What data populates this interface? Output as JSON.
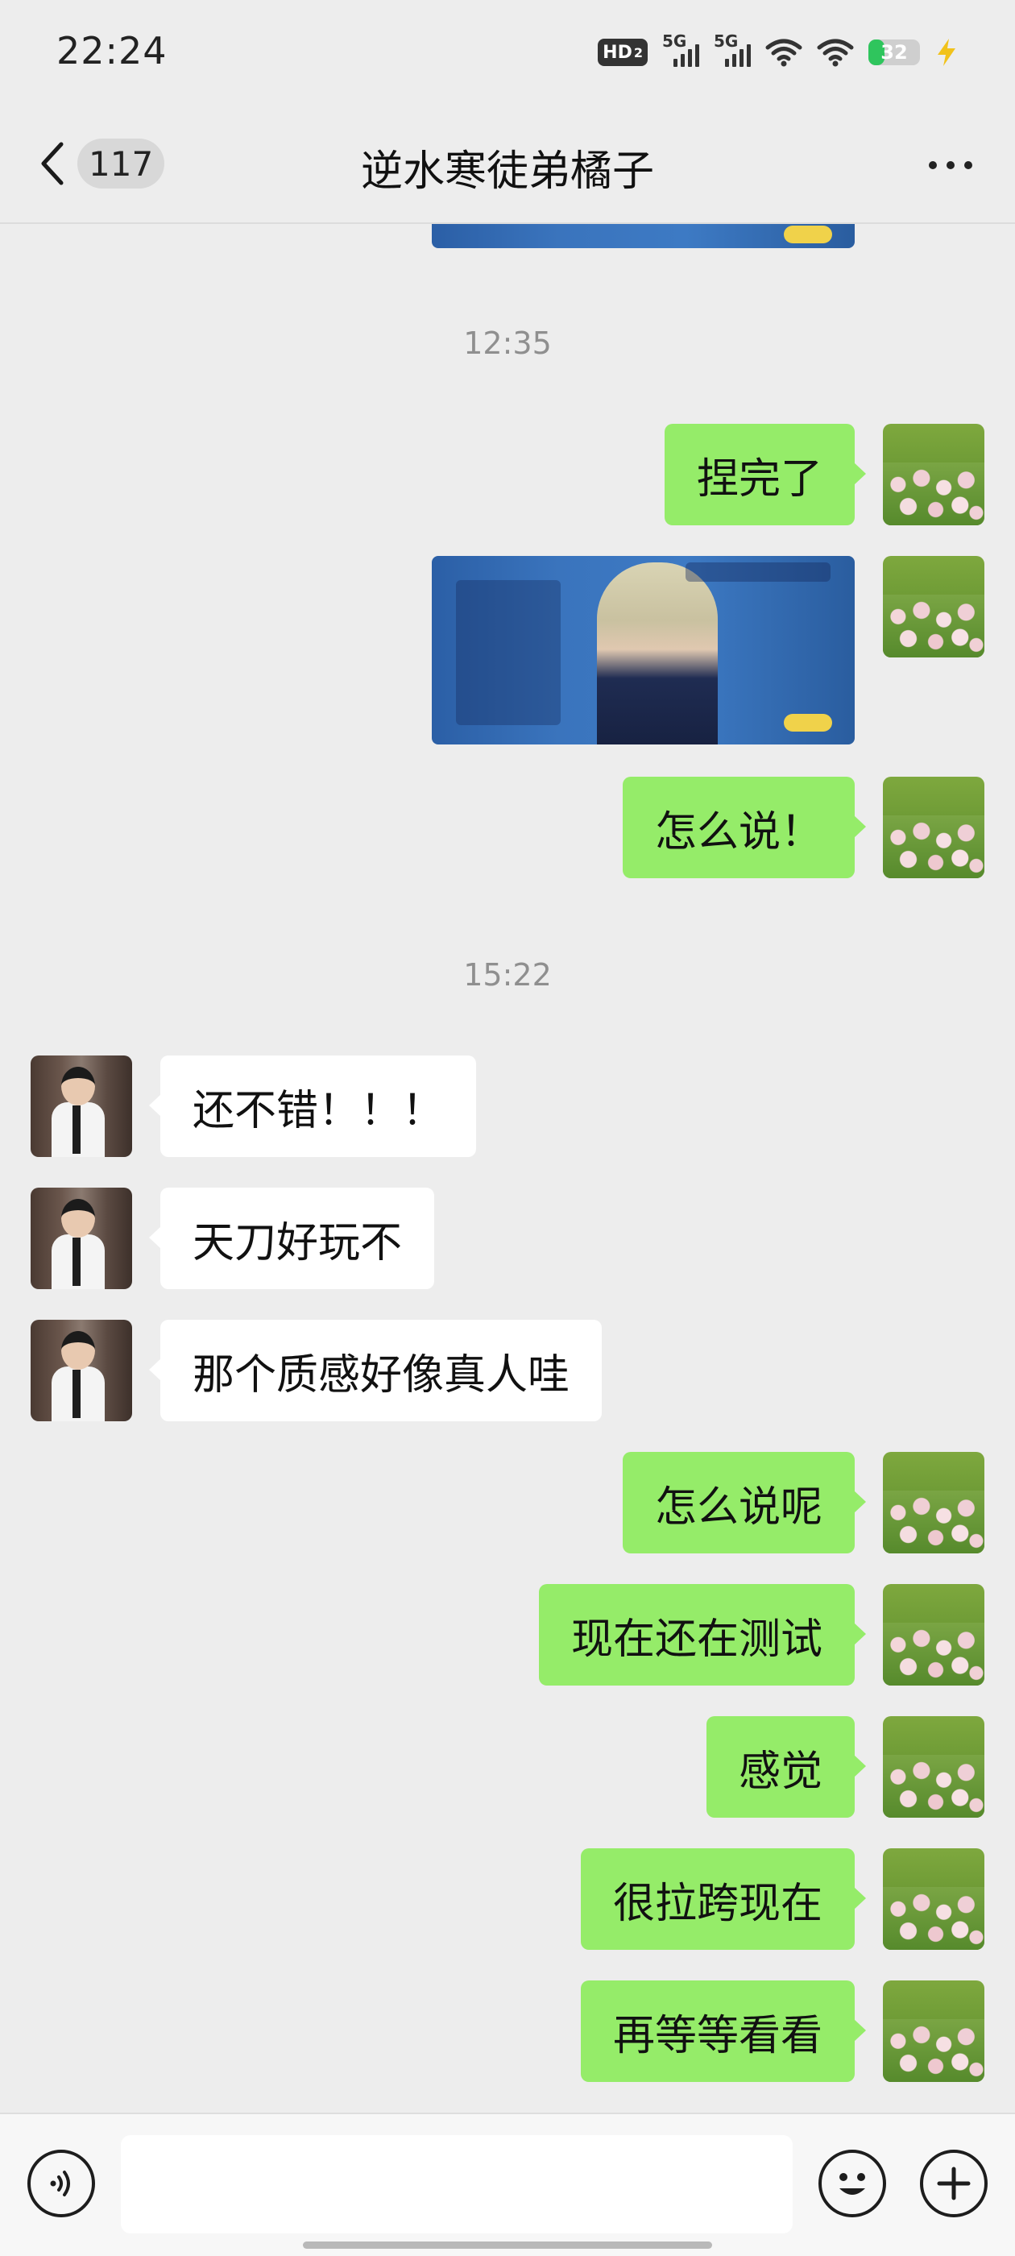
{
  "status_bar": {
    "time": "22:24",
    "network_badge": "HD",
    "network_badge_sub": "2",
    "signal_1_label": "5G",
    "signal_2_label": "5G",
    "battery_level": "32",
    "battery_fraction": 0.32,
    "icons": [
      "hd-icon",
      "signal-icon",
      "signal-icon",
      "wifi-icon",
      "battery-icon",
      "charging-icon"
    ]
  },
  "nav": {
    "unread_count": "117",
    "title": "逆水寒徒弟橘子",
    "back_icon": "chevron-left-icon",
    "more_icon": "more-dots-icon"
  },
  "timestamps": [
    "12:35",
    "15:22"
  ],
  "messages": {
    "m1": "捏完了",
    "m2_image": "character-creation-screenshot",
    "m3": "怎么说！",
    "m4": "还不错！！！",
    "m5": "天刀好玩不",
    "m6": "那个质感好像真人哇",
    "m7": "怎么说呢",
    "m8": "现在还在测试",
    "m9": "感觉",
    "m10": "很拉跨现在",
    "m11": "再等等看看"
  },
  "input": {
    "value": "",
    "voice_icon": "voice-icon",
    "emoji_icon": "emoji-icon",
    "plus_icon": "plus-icon"
  },
  "colors": {
    "self_bubble": "#95ec69",
    "friend_bubble": "#ffffff",
    "background": "#ededed",
    "battery": "#2fc55d"
  }
}
